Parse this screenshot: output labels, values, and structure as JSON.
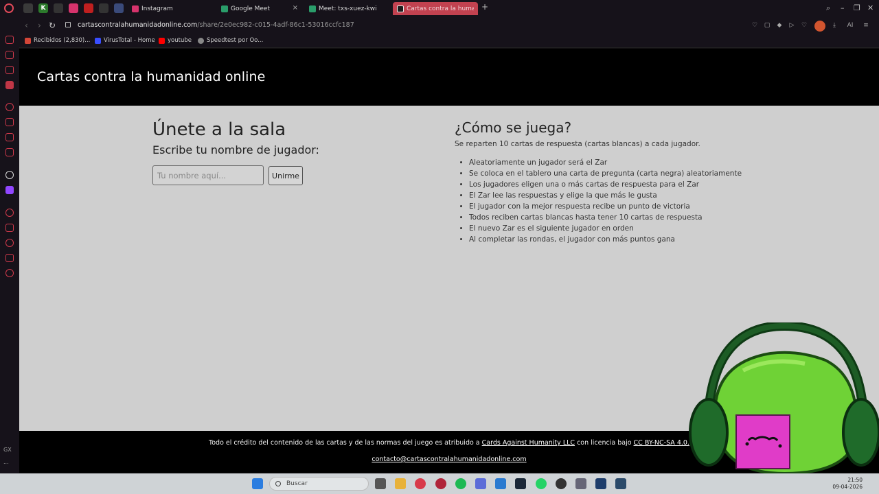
{
  "browser": {
    "tabs": [
      {
        "label": "Instagram",
        "color": "#d6336c"
      },
      {
        "label": "Google Meet",
        "color": "#2a9d6a"
      },
      {
        "label": "Meet: txs-xuez-kwi",
        "color": "#2a9d6a"
      },
      {
        "label": "Cartas contra la humanidad",
        "color": "#222222",
        "active": true
      }
    ],
    "url": {
      "host": "cartascontralahumanidadonline.com",
      "path": "/share/2e0ec982-c015-4adf-86c1-53016ccfc187"
    },
    "bookmarks": [
      {
        "label": "Recibidos (2,830)...",
        "icon": "mail-icon",
        "color": "#d44638"
      },
      {
        "label": "VirusTotal - Home",
        "icon": "virustotal-icon",
        "color": "#394eff"
      },
      {
        "label": "youtube",
        "icon": "youtube-icon",
        "color": "#ff0000"
      },
      {
        "label": "Speedtest por Oo...",
        "icon": "speedtest-icon",
        "color": "#888888"
      }
    ],
    "sidebar_footer": {
      "gx_label": "GX",
      "more_label": "..."
    },
    "accent_color": "#c24250"
  },
  "page": {
    "site_title": "Cartas contra la humanidad online",
    "join": {
      "title": "Únete a la sala",
      "subtitle": "Escribe tu nombre de jugador:",
      "input_placeholder": "Tu nombre aquí...",
      "button_label": "Unirme"
    },
    "howto": {
      "title": "¿Cómo se juega?",
      "intro": "Se reparten 10 cartas de respuesta (cartas blancas) a cada jugador.",
      "rules": [
        "Aleatoriamente un jugador será el Zar",
        "Se coloca en el tablero una carta de pregunta (carta negra) aleatoriamente",
        "Los jugadores eligen una o más cartas de respuesta para el Zar",
        "El Zar lee las respuestas y elige la que más le gusta",
        "El jugador con la mejor respuesta recibe un punto de victoria",
        "Todos reciben cartas blancas hasta tener 10 cartas de respuesta",
        "El nuevo Zar es el siguiente jugador en orden",
        "Al completar las rondas, el jugador con más puntos gana"
      ]
    },
    "footer": {
      "credit_prefix": "Todo el crédito del contenido de las cartas y de las normas del juego es atribuido a ",
      "credit_link": "Cards Against Humanity LLC",
      "credit_middle": " con licencia bajo ",
      "license_link": "CC BY-NC-SA 4.0.",
      "contact_email": "contacto@cartascontralahumanidadonline.com"
    }
  },
  "taskbar": {
    "search_placeholder": "Buscar",
    "time": "21:50",
    "date": "09-04-2026"
  }
}
